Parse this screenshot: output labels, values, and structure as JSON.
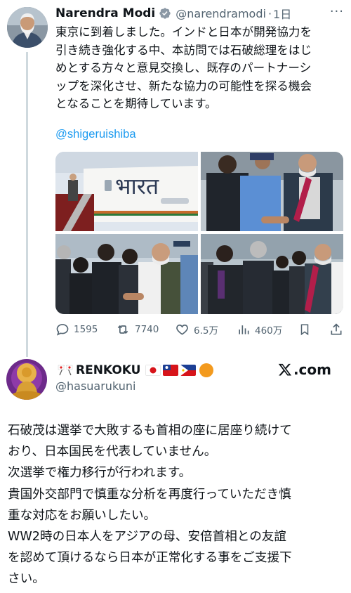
{
  "post1": {
    "display_name": "Narendra Modi",
    "handle": "@narendramodi",
    "separator": "·",
    "time": "1日",
    "more_icon": "more-dots-icon",
    "verified_icon": "verified-badge-icon",
    "body_lines": [
      "東京に到着しました。インドと日本が開発協力を",
      "引き続き強化する中、本訪問では石破総理をはじ",
      "めとする方々と意見交換し、既存のパートナーシ",
      "ップを深化させ、新たな協力の可能性を探る機会",
      "となることを期待しています。"
    ],
    "mention": "@shigeruishiba",
    "photos": {
      "aircraft_script": "भारत"
    },
    "metrics": {
      "replies": "1595",
      "reposts": "7740",
      "likes": "6.5万",
      "views": "460万"
    }
  },
  "post2": {
    "display_name": "RENKOKU",
    "handle": "@hasuarukuni",
    "emoji_sequence": [
      "crossed-flags",
      "japan-flag",
      "taiwan-flag",
      "philippines-flag",
      "orange-circle"
    ],
    "watermark": "X.com",
    "body": "石破茂は選挙で大敗するも首相の座に居座り続けて\nおり、日本国民を代表していません。\n次選挙で権力移行が行われます。\n貴国外交部門で慎重な分析を再度行っていただき慎\n重な対応をお願いしたい。\nWW2時の日本人をアジアの母、安倍首相との友誼\nを認めて頂けるなら日本が正常化する事をご支援下\nさい。"
  },
  "colors": {
    "link": "#1d9bf0",
    "muted": "#536471",
    "text": "#0f1419",
    "verified": "#8b98a5"
  }
}
